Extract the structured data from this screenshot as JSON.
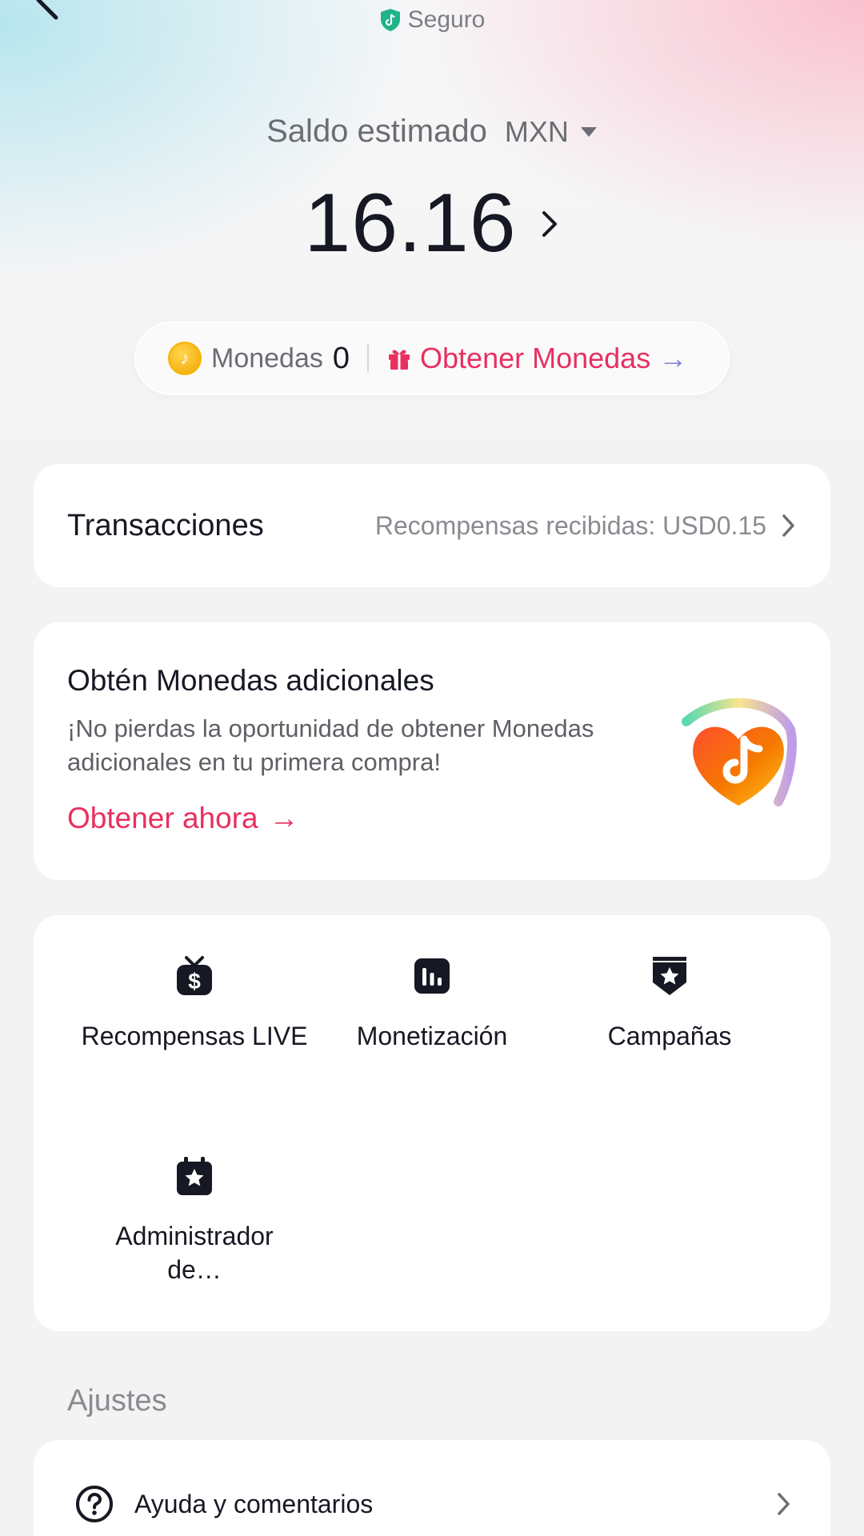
{
  "header": {
    "secure_label": "Seguro"
  },
  "balance": {
    "label": "Saldo estimado",
    "currency": "MXN",
    "amount": "16.16"
  },
  "coins": {
    "label": "Monedas",
    "count": "0",
    "get_label": "Obtener Monedas",
    "arrow": "→"
  },
  "transactions": {
    "title": "Transacciones",
    "rewards_text": "Recompensas recibidas: USD0.15"
  },
  "promo": {
    "title": "Obtén Monedas adicionales",
    "description": "¡No pierdas la oportunidad de obtener Monedas adicionales en tu primera compra!",
    "link": "Obtener ahora",
    "arrow": "→"
  },
  "tools": [
    {
      "label": "Recompensas LIVE",
      "icon": "dollar-gift-icon"
    },
    {
      "label": "Monetización",
      "icon": "chart-bars-icon"
    },
    {
      "label": "Campañas",
      "icon": "star-shield-icon"
    },
    {
      "label": "Administrador de…",
      "icon": "calendar-star-icon"
    }
  ],
  "settings": {
    "section_title": "Ajustes",
    "items": [
      {
        "label": "Ayuda y comentarios",
        "icon": "help-circle-icon"
      }
    ]
  },
  "colors": {
    "accent": "#e8305f",
    "secure_green": "#20b38a",
    "text": "#161823",
    "muted": "#8a8b91"
  }
}
